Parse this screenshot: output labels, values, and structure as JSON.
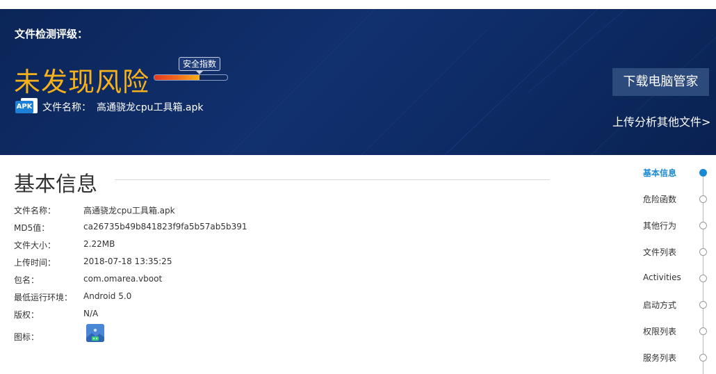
{
  "banner": {
    "rating_label": "文件检测评级：",
    "verdict": "未发现风险",
    "safety_tag": "安全指数",
    "safety_level": 0.62,
    "apk_badge": "APK",
    "file_label": "文件名称：",
    "file_name": "高通骁龙cpu工具箱.apk",
    "download_button": "下载电脑管家",
    "upload_link": "上传分析其他文件>",
    "colors": {
      "background": "#0b2558",
      "verdict": "#f7b21b"
    }
  },
  "basic_info": {
    "title": "基本信息",
    "rows": [
      {
        "key": "文件名称：",
        "value": "高通骁龙cpu工具箱.apk"
      },
      {
        "key": "MD5值：",
        "value": "ca26735b49b841823f9fa5b57ab5b391"
      },
      {
        "key": "文件大小：",
        "value": "2.22MB"
      },
      {
        "key": "上传时间：",
        "value": "2018-07-18 13:35:25"
      },
      {
        "key": "包名：",
        "value": "com.omarea.vboot"
      },
      {
        "key": "最低运行环境：",
        "value": "Android 5.0"
      },
      {
        "key": "版权：",
        "value": "N/A"
      },
      {
        "key": "图标：",
        "value": ""
      }
    ],
    "icon_name": "app-image-icon"
  },
  "side_nav": {
    "active_color": "#1a8ad4",
    "items": [
      {
        "label": "基本信息",
        "active": true
      },
      {
        "label": "危险函数",
        "active": false
      },
      {
        "label": "其他行为",
        "active": false
      },
      {
        "label": "文件列表",
        "active": false
      },
      {
        "label": "Activities",
        "active": false
      },
      {
        "label": "启动方式",
        "active": false
      },
      {
        "label": "权限列表",
        "active": false
      },
      {
        "label": "服务列表",
        "active": false
      }
    ]
  }
}
